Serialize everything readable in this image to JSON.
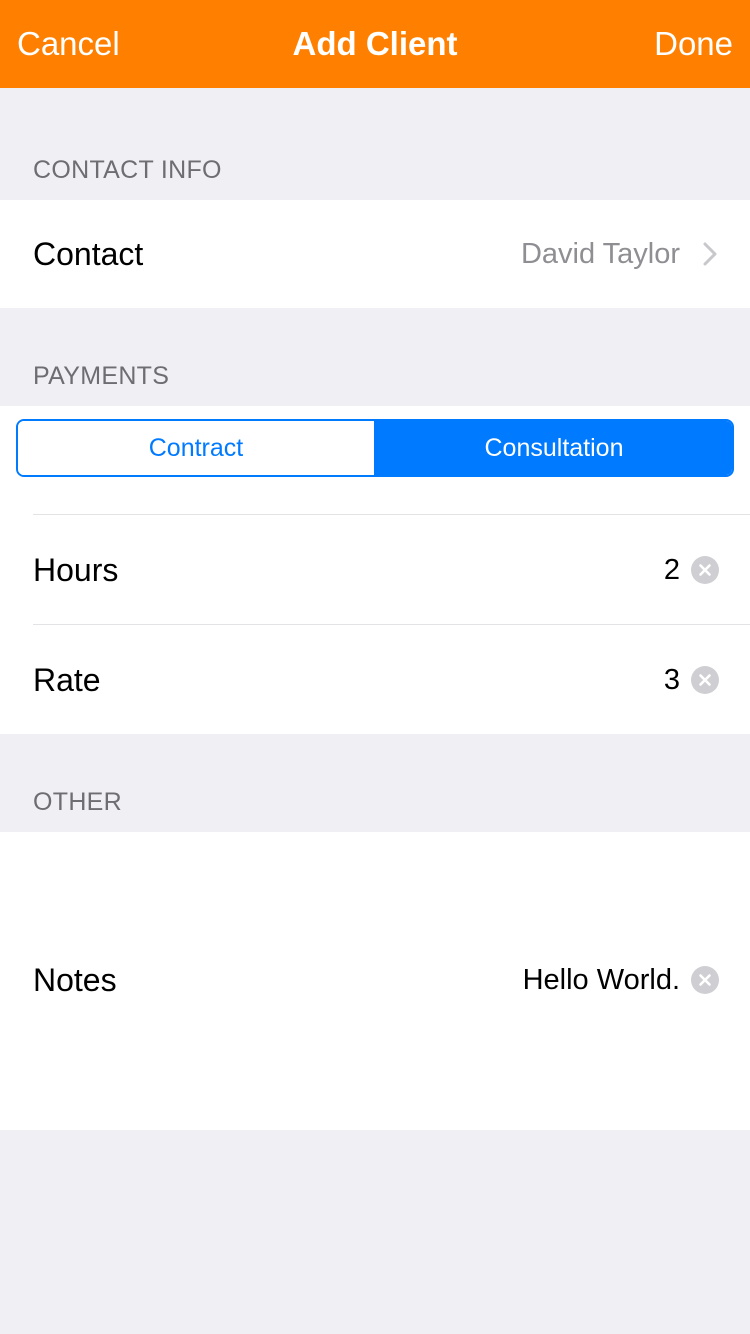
{
  "nav": {
    "cancel_label": "Cancel",
    "title": "Add Client",
    "done_label": "Done",
    "background_color": "#ff8000"
  },
  "sections": {
    "contact_info": {
      "header": "CONTACT INFO",
      "contact": {
        "label": "Contact",
        "value": "David Taylor",
        "accessory_icon": "chevron-right-icon"
      }
    },
    "payments": {
      "header": "PAYMENTS",
      "segments": [
        {
          "label": "Contract",
          "selected": false
        },
        {
          "label": "Consultation",
          "selected": true
        }
      ],
      "hours": {
        "label": "Hours",
        "value": "2",
        "accessory_icon": "clear-icon"
      },
      "rate": {
        "label": "Rate",
        "value": "3",
        "accessory_icon": "clear-icon"
      }
    },
    "other": {
      "header": "OTHER",
      "notes": {
        "label": "Notes",
        "value": "Hello World.",
        "accessory_icon": "clear-icon"
      }
    }
  },
  "colors": {
    "accent": "#007aff",
    "background": "#efeff4",
    "secondary_text": "#8e8e93"
  }
}
